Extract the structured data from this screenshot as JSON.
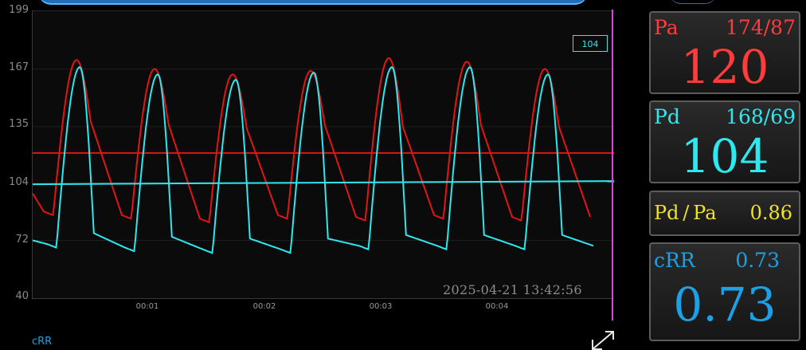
{
  "plot": {
    "y_ticks": [
      "199",
      "167",
      "135",
      "104",
      "72",
      "40"
    ],
    "x_ticks": [
      "00:01",
      "00:02",
      "00:03",
      "00:04"
    ],
    "timestamp": "2025-04-21 13:42:56",
    "pd_marker_label": "104",
    "footer_label": "cRR",
    "colors": {
      "pa_trace": "#e01616",
      "pd_trace": "#2ee8f0",
      "cursor": "#d34ad3",
      "grid": "#1e1e1e"
    }
  },
  "chart_data": {
    "type": "line",
    "ylim": [
      40,
      199
    ],
    "yticks": [
      40,
      72,
      104,
      135,
      167,
      199
    ],
    "x_unit": "mm:ss",
    "xticks": [
      "00:01",
      "00:02",
      "00:03",
      "00:04"
    ],
    "series": [
      {
        "name": "Pa",
        "color": "#e01616",
        "systolic_peaks": [
          172,
          167,
          164,
          166,
          173,
          171,
          167
        ],
        "diastolic_troughs": [
          88,
          86,
          84,
          86,
          85,
          86,
          85
        ],
        "mean_level": 120
      },
      {
        "name": "Pd",
        "color": "#2ee8f0",
        "systolic_peaks": [
          168,
          164,
          161,
          165,
          168,
          168,
          164
        ],
        "diastolic_troughs": [
          70,
          68,
          67,
          67,
          69,
          69,
          69
        ],
        "mean_level": 104
      }
    ]
  },
  "cards": {
    "pa": {
      "label": "Pa",
      "range": "174/87",
      "value": "120",
      "color": "#ff3b3b"
    },
    "pd": {
      "label": "Pd",
      "range": "168/69",
      "value": "104",
      "color": "#2ee8f0"
    },
    "ratio": {
      "label": "Pd / Pa",
      "value": "0.86",
      "color": "#f2e02a"
    },
    "crr": {
      "label": "cRR",
      "range": "0.73",
      "value": "0.73",
      "color": "#1ea0e6"
    }
  },
  "icons": {
    "expand": "expand-icon"
  }
}
